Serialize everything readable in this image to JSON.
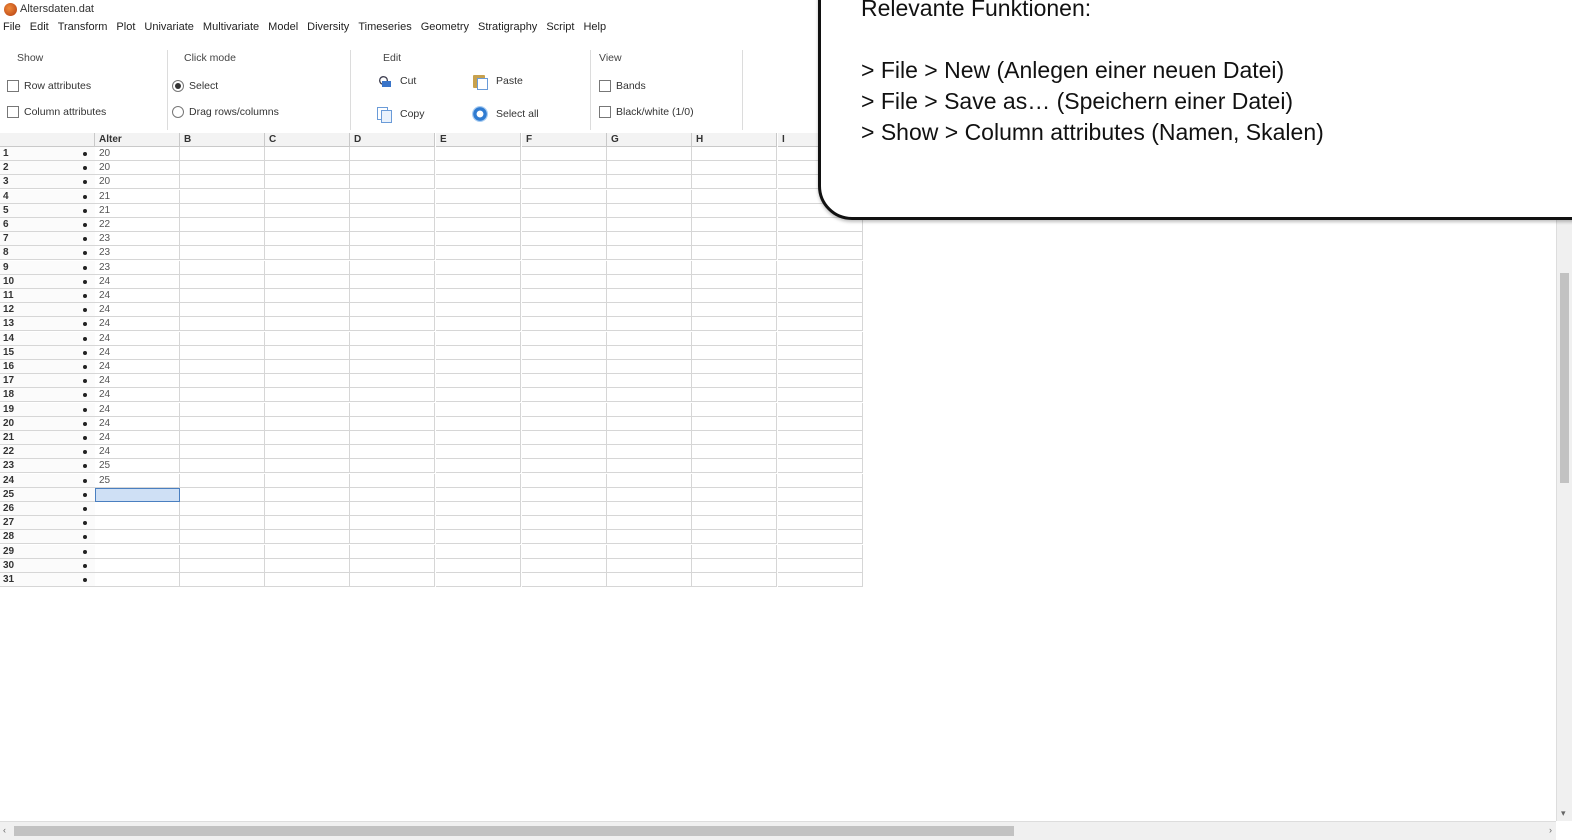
{
  "window": {
    "title": "Altersdaten.dat",
    "icon": "past-app-icon"
  },
  "menu": [
    "File",
    "Edit",
    "Transform",
    "Plot",
    "Univariate",
    "Multivariate",
    "Model",
    "Diversity",
    "Timeseries",
    "Geometry",
    "Stratigraphy",
    "Script",
    "Help"
  ],
  "ribbon": {
    "show": {
      "title": "Show",
      "row_attributes": "Row attributes",
      "column_attributes": "Column attributes"
    },
    "click_mode": {
      "title": "Click mode",
      "select": "Select",
      "drag": "Drag rows/columns",
      "selected": "Select"
    },
    "edit": {
      "title": "Edit",
      "cut": "Cut",
      "copy": "Copy",
      "paste": "Paste",
      "select_all": "Select all"
    },
    "view": {
      "title": "View",
      "bands": "Bands",
      "black_white": "Black/white (1/0)"
    }
  },
  "grid": {
    "columns": [
      "Alter",
      "B",
      "C",
      "D",
      "E",
      "F",
      "G",
      "H",
      "I"
    ],
    "rows": [
      {
        "n": "1",
        "v": "20"
      },
      {
        "n": "2",
        "v": "20"
      },
      {
        "n": "3",
        "v": "20"
      },
      {
        "n": "4",
        "v": "21"
      },
      {
        "n": "5",
        "v": "21"
      },
      {
        "n": "6",
        "v": "22"
      },
      {
        "n": "7",
        "v": "23"
      },
      {
        "n": "8",
        "v": "23"
      },
      {
        "n": "9",
        "v": "23"
      },
      {
        "n": "10",
        "v": "24"
      },
      {
        "n": "11",
        "v": "24"
      },
      {
        "n": "12",
        "v": "24"
      },
      {
        "n": "13",
        "v": "24"
      },
      {
        "n": "14",
        "v": "24"
      },
      {
        "n": "15",
        "v": "24"
      },
      {
        "n": "16",
        "v": "24"
      },
      {
        "n": "17",
        "v": "24"
      },
      {
        "n": "18",
        "v": "24"
      },
      {
        "n": "19",
        "v": "24"
      },
      {
        "n": "20",
        "v": "24"
      },
      {
        "n": "21",
        "v": "24"
      },
      {
        "n": "22",
        "v": "24"
      },
      {
        "n": "23",
        "v": "25"
      },
      {
        "n": "24",
        "v": "25"
      },
      {
        "n": "25",
        "v": ""
      },
      {
        "n": "26",
        "v": ""
      },
      {
        "n": "27",
        "v": ""
      },
      {
        "n": "28",
        "v": ""
      },
      {
        "n": "29",
        "v": ""
      },
      {
        "n": "30",
        "v": ""
      },
      {
        "n": "31",
        "v": ""
      }
    ],
    "selected_row": "25",
    "selected_column": "Alter"
  },
  "callout": {
    "lines": [
      "Relevante Funktionen:",
      "",
      "> File > New (Anlegen einer neuen Datei)",
      "> File > Save as… (Speichern einer Datei)",
      "> Show > Column attributes (Namen, Skalen)"
    ]
  }
}
